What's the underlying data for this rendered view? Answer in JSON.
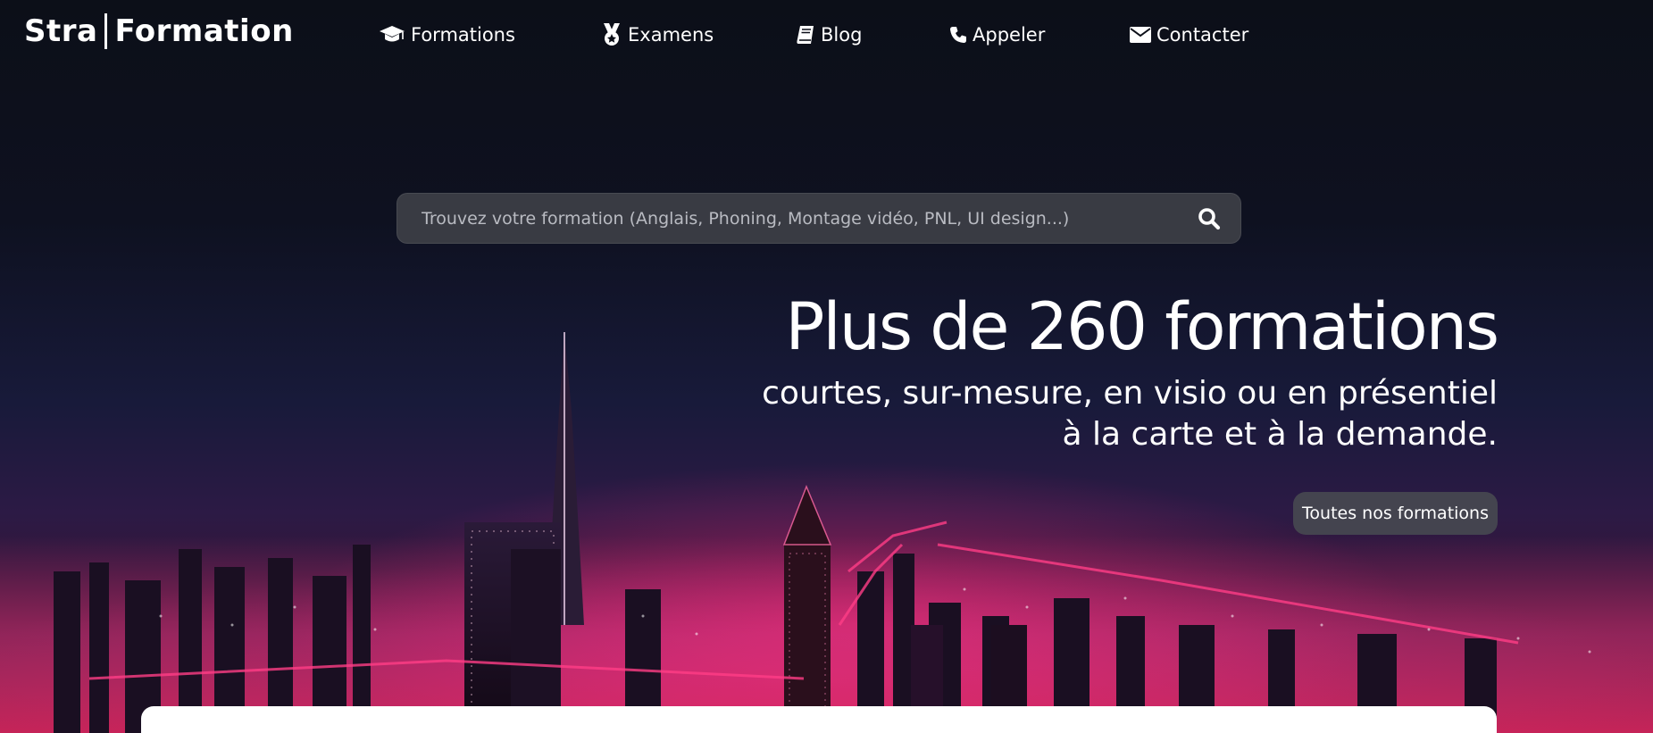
{
  "header": {
    "logo": {
      "left": "Stra",
      "right": "Formation"
    },
    "nav": [
      {
        "label": "Formations",
        "icon": "graduation-cap-icon"
      },
      {
        "label": "Examens",
        "icon": "medal-icon"
      },
      {
        "label": "Blog",
        "icon": "book-icon"
      },
      {
        "label": "Appeler",
        "icon": "phone-icon"
      },
      {
        "label": "Contacter",
        "icon": "envelope-icon"
      }
    ]
  },
  "search": {
    "placeholder": "Trouvez votre formation (Anglais, Phoning, Montage vidéo, PNL, UI design...)",
    "icon": "search-icon"
  },
  "hero": {
    "title": "Plus de 260 formations",
    "subtitle_line1": "courtes, sur-mesure, en visio ou en présentiel",
    "subtitle_line2": "à la carte et à la demande.",
    "cta_label": "Toutes nos formations"
  },
  "colors": {
    "background": "#0c0f18",
    "text": "#ffffff",
    "search_bg": "#3c3e46",
    "city_glow": "#ff2878"
  }
}
